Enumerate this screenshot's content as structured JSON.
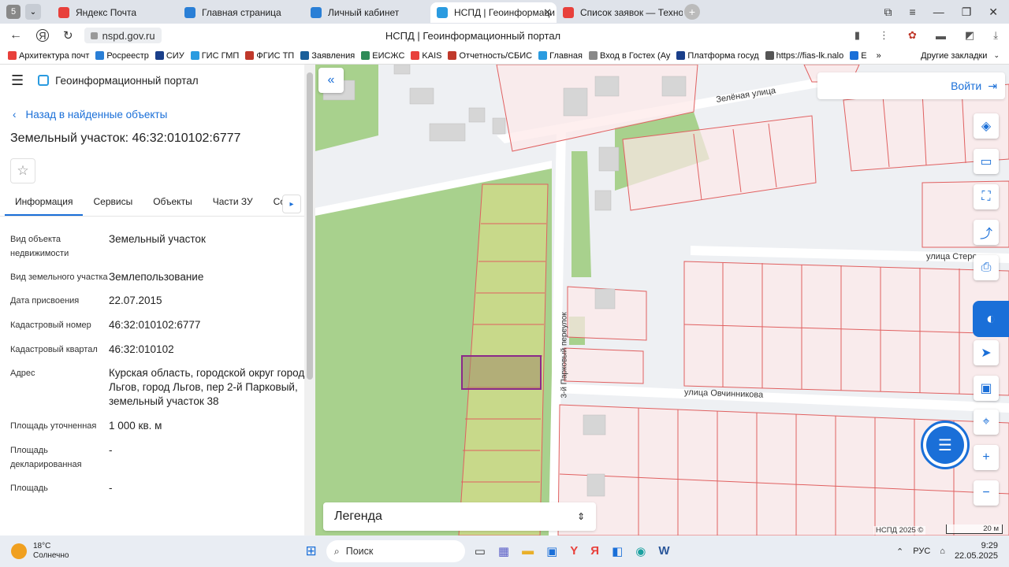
{
  "browser": {
    "tabs": [
      {
        "label": "Яндекс Почта",
        "color": "#e8403b"
      },
      {
        "label": "Главная страница",
        "color": "#2a7fd6"
      },
      {
        "label": "Личный кабинет",
        "color": "#2a7fd6"
      },
      {
        "label": "НСПД | Геоинформаци",
        "color": "#2a9be0",
        "active": true
      },
      {
        "label": "Список заявок — ТехноК",
        "color": "#e8403b"
      }
    ],
    "address": "nspd.gov.ru",
    "page_title": "НСПД | Геоинформационный портал",
    "bookmarks": [
      "Архитектура почт",
      "Росреестр",
      "СИУ",
      "ГИС ГМП",
      "ФГИС ТП",
      "Заявления",
      "ЕИСЖС",
      "KAIS",
      "Отчетность/СБИС",
      "Главная",
      "Вход в Гостех (Ау",
      "Платформа госуд",
      "https://fias-lk.nalo",
      "Е"
    ],
    "other_bookmarks": "Другие закладки"
  },
  "portal": {
    "title": "Геоинформационный портал",
    "back_link": "Назад в найденные объекты",
    "object_title": "Земельный участок: 46:32:010102:6777",
    "tabs": [
      "Информация",
      "Сервисы",
      "Объекты",
      "Части ЗУ",
      "Соста"
    ],
    "fields": [
      {
        "label": "Вид объекта недвижимости",
        "value": "Земельный участок"
      },
      {
        "label": "Вид земельного участка",
        "value": "Землепользование"
      },
      {
        "label": "Дата присвоения",
        "value": "22.07.2015"
      },
      {
        "label": "Кадастровый номер",
        "value": "46:32:010102:6777"
      },
      {
        "label": "Кадастровый квартал",
        "value": "46:32:010102"
      },
      {
        "label": "Адрес",
        "value": "Курская область, городской округ город Льгов, город Льгов, пер 2-й Парковый, земельный участок 38"
      },
      {
        "label": "Площадь уточненная",
        "value": "1 000 кв. м"
      },
      {
        "label": "Площадь декларированная",
        "value": "-"
      },
      {
        "label": "Площадь",
        "value": "-"
      }
    ]
  },
  "map": {
    "login": "Войти",
    "legend": "Легенда",
    "streets": [
      "Зелёная улица",
      "улица Стере",
      "улица Овчинникова",
      "3-й Парковый переулок"
    ],
    "copyright": "НСПД 2025 ©",
    "scale": "20 м"
  },
  "taskbar": {
    "temp": "18°C",
    "weather": "Солнечно",
    "search": "Поиск",
    "lang": "РУС",
    "time": "9:29",
    "date": "22.05.2025"
  }
}
